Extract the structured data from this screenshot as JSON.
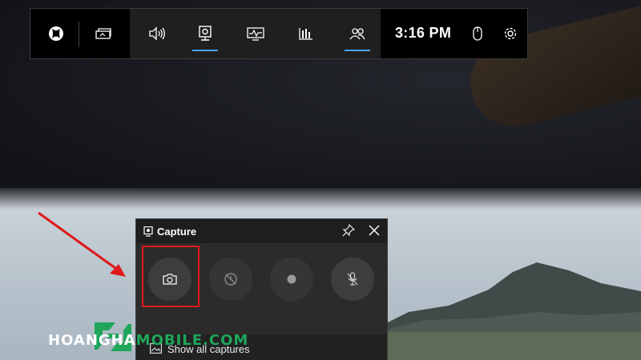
{
  "gamebar": {
    "time": "3:16 PM",
    "icons": [
      "xbox-icon",
      "widget-menu-icon",
      "audio-icon",
      "capture-icon",
      "performance-icon",
      "resources-icon",
      "social-icon",
      "mouse-icon",
      "gear-icon"
    ]
  },
  "capture": {
    "title": "Capture",
    "buttons": [
      "screenshot",
      "record-last-30s",
      "start-recording",
      "mic-muted"
    ],
    "show_all": "Show all captures"
  },
  "watermark": {
    "prefix": "HOANGHA",
    "suffix": "MOBILE.COM"
  },
  "colors": {
    "accent": "#4aa3e8",
    "highlight": "#e0191b",
    "brand_green": "#1fa65a"
  }
}
